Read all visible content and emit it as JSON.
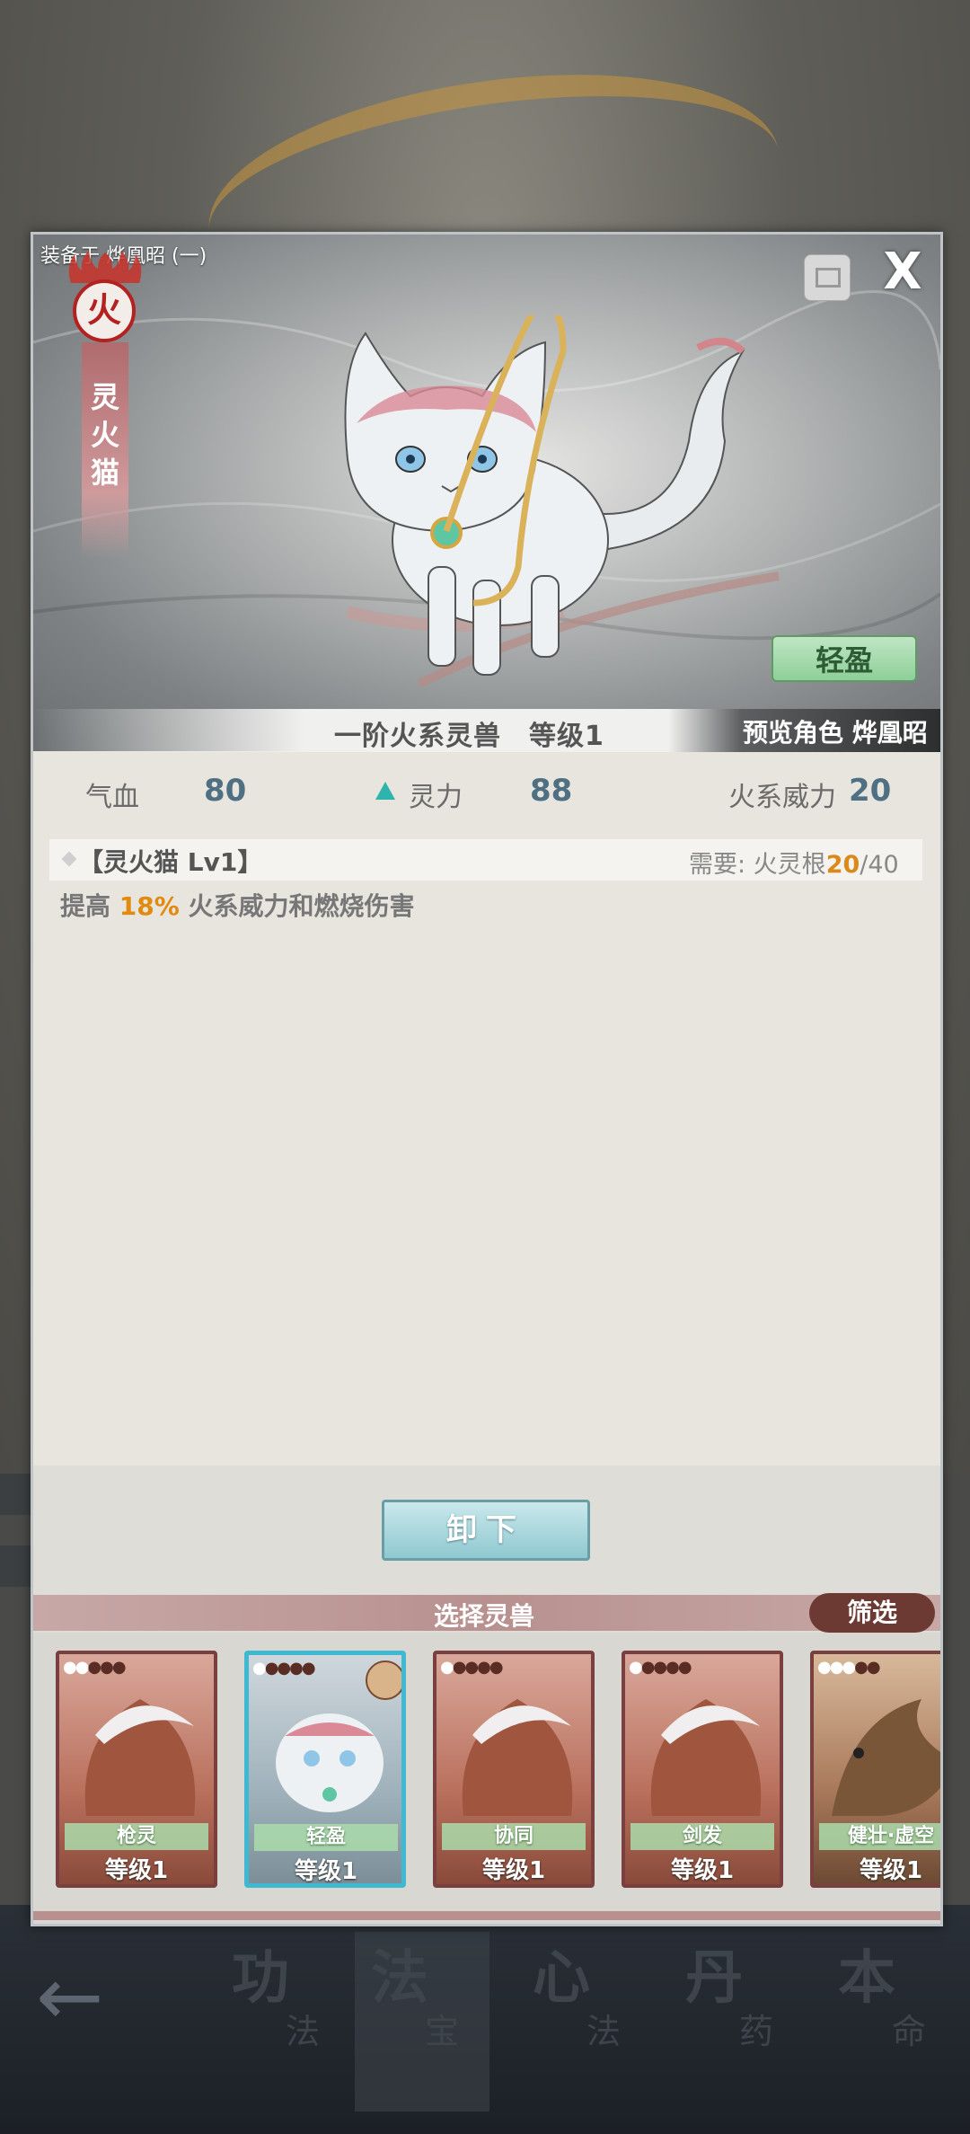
{
  "panel": {
    "equip_label": "装备于 烨凰昭 (一)",
    "element_char": "火",
    "beast_name_chars": [
      "灵",
      "火",
      "猫"
    ],
    "close_label": "X",
    "trait_button": "轻盈",
    "rank_text": "一阶火系灵兽　等级1",
    "preview_text": "预览角色 烨凰昭"
  },
  "stats": {
    "hp_label": "气血",
    "hp_value": "80",
    "spirit_label": "灵力",
    "spirit_value": "88",
    "fire_label": "火系威力",
    "fire_value": "20"
  },
  "skill": {
    "name": "【灵火猫 Lv1】",
    "req_prefix": "需要:  火灵根",
    "req_current": "20",
    "req_total": "/40",
    "desc_prefix": "提高 ",
    "desc_value": "18%",
    "desc_suffix": " 火系威力和燃烧伤害"
  },
  "actions": {
    "unequip": "卸下",
    "select_title": "选择灵兽",
    "filter": "筛选"
  },
  "cards": [
    {
      "name": "枪灵",
      "level": "等级1",
      "paws_on": 2,
      "selected": false
    },
    {
      "name": "轻盈",
      "level": "等级1",
      "paws_on": 1,
      "selected": true
    },
    {
      "name": "协同",
      "level": "等级1",
      "paws_on": 1,
      "selected": false
    },
    {
      "name": "剑发",
      "level": "等级1",
      "paws_on": 1,
      "selected": false
    },
    {
      "name": "健壮·虚空",
      "level": "等级1",
      "paws_on": 3,
      "selected": false
    }
  ],
  "nav": [
    {
      "big": "功",
      "small": "法"
    },
    {
      "big": "法",
      "small": "宝"
    },
    {
      "big": "心",
      "small": "法"
    },
    {
      "big": "丹",
      "small": "药"
    },
    {
      "big": "本",
      "small": "命"
    }
  ],
  "nav_back": "←",
  "colors": {
    "accent_fire": "#b32121",
    "stat_value": "#4f6f83",
    "highlight": "#e08a10",
    "selected_border": "#3fb9d2",
    "filter_bg": "#6d3a33"
  }
}
